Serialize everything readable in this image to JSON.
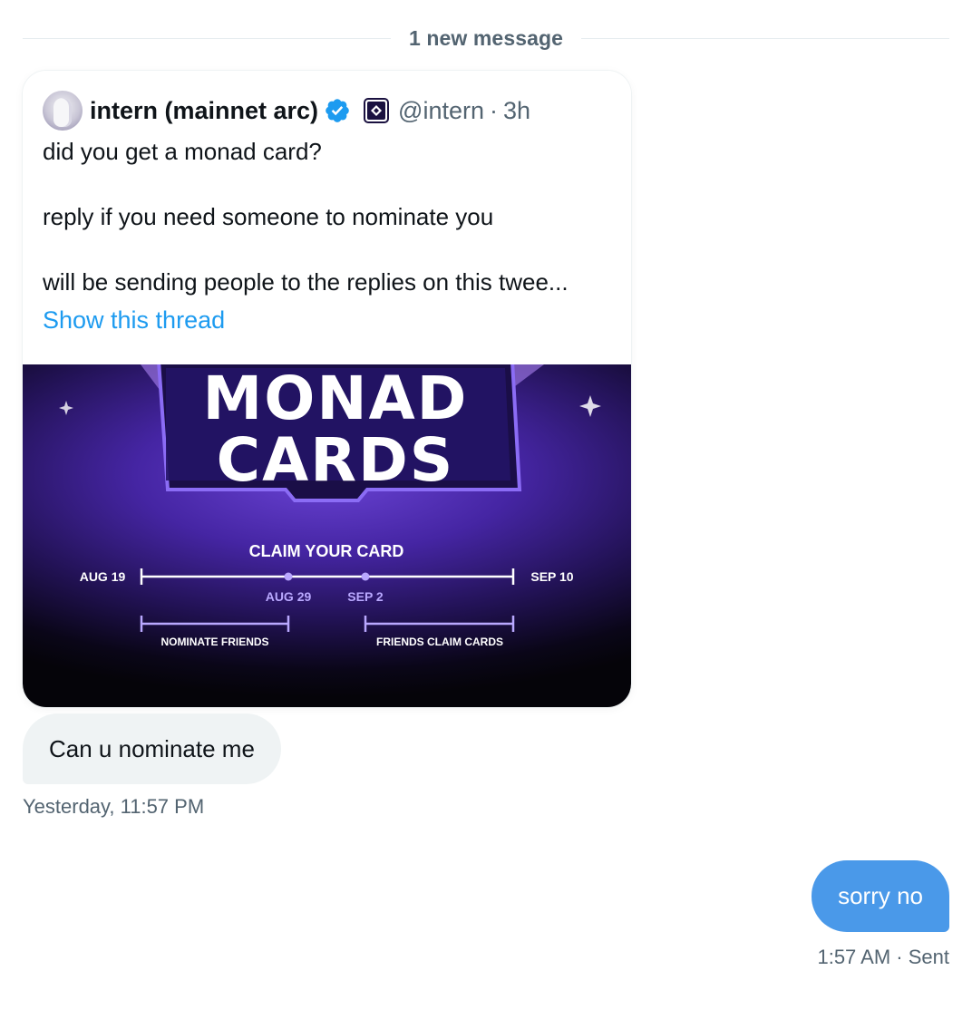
{
  "divider": {
    "label": "1 new message"
  },
  "quoted_tweet": {
    "author_name": "intern (mainnet arc)",
    "handle": "@intern",
    "separator": "·",
    "time_ago": "3h",
    "lines": [
      "did you get a monad card?",
      "reply if you need someone to nominate you",
      "will be sending people to the replies on this twee..."
    ],
    "show_thread": "Show this thread",
    "verified_color": "#1d9bf0",
    "media": {
      "logo_top": "MONAD",
      "logo_bottom": "CARDS",
      "timeline_title": "CLAIM YOUR CARD",
      "start_date": "AUG 19",
      "end_date": "SEP 10",
      "mid_dates": [
        "AUG 29",
        "SEP 2"
      ],
      "phase_labels": [
        "NOMINATE FRIENDS",
        "FRIENDS CLAIM CARDS"
      ]
    }
  },
  "messages": [
    {
      "direction": "incoming",
      "text": "Can u nominate me",
      "timestamp": "Yesterday, 11:57 PM"
    },
    {
      "direction": "outgoing",
      "text": "sorry no",
      "timestamp": "1:57 AM · Sent",
      "bubble_color": "#4a99e9"
    }
  ]
}
